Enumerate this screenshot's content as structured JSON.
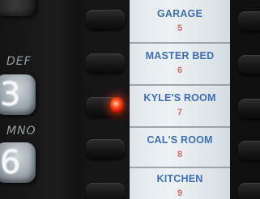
{
  "keypad": {
    "digit_top": "3",
    "letters_top": "DEF",
    "digit_bottom": "6",
    "letters_bottom": "MNO"
  },
  "labels": [
    {
      "room": "GARAGE",
      "number": "5"
    },
    {
      "room": "MASTER BED",
      "number": "6"
    },
    {
      "room": "KYLE'S ROOM",
      "number": "7"
    },
    {
      "room": "CAL'S ROOM",
      "number": "8"
    },
    {
      "room": "KITCHEN",
      "number": "9"
    }
  ],
  "indicator": {
    "active_label": "KYLE'S ROOM",
    "color": "#ff3a10"
  },
  "colors": {
    "label_text": "#3d6fb2",
    "number_text": "#d86a62"
  }
}
